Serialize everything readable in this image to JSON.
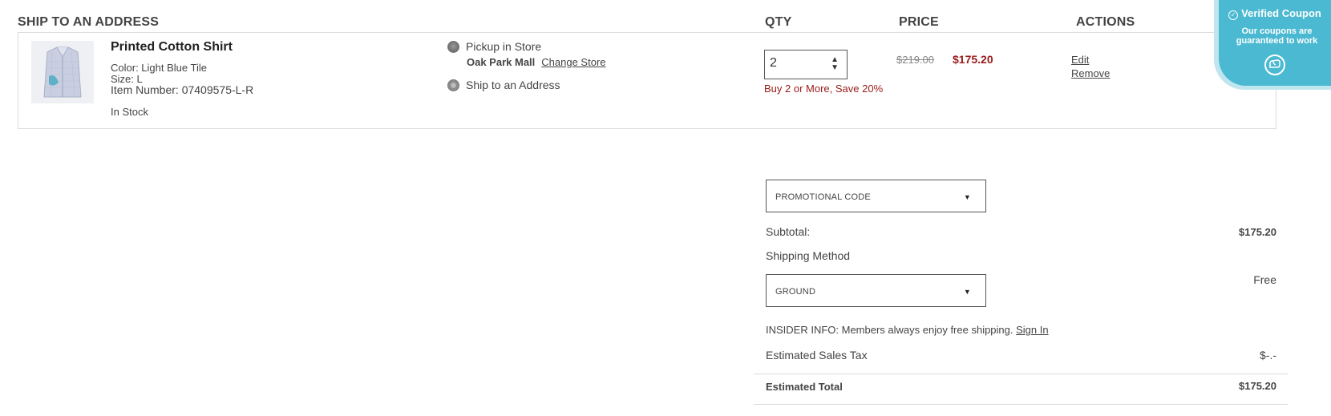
{
  "headers": {
    "ship_to": "SHIP TO AN ADDRESS",
    "qty": "QTY",
    "price": "PRICE",
    "actions": "ACTIONS"
  },
  "item": {
    "name": "Printed Cotton Shirt",
    "color": "Color: Light Blue Tile",
    "size": "Size: L",
    "item_number": "Item Number: 07409575-L-R",
    "stock": "In Stock",
    "fulfillment": {
      "pickup_label": "Pickup in Store",
      "store_name": "Oak Park Mall",
      "change_store": "Change Store",
      "ship_label": "Ship to an Address",
      "selected": "ship"
    },
    "qty": "2",
    "qty_promo": "Buy 2 or More, Save 20%",
    "price_original": "$219.00",
    "price_sale": "$175.20",
    "actions": {
      "edit": "Edit",
      "remove": "Remove"
    }
  },
  "coupon_badge": {
    "title": "Verified Coupon",
    "text": "Our coupons are guaranteed to work"
  },
  "summary": {
    "promo_dropdown": "PROMOTIONAL CODE",
    "subtotal_label": "Subtotal:",
    "subtotal_value": "$175.20",
    "shipping_method_label": "Shipping Method",
    "shipping_dropdown": "GROUND",
    "shipping_value": "Free",
    "insider_text": "INSIDER INFO: Members always enjoy free shipping.",
    "sign_in": "Sign In",
    "tax_label": "Estimated Sales Tax",
    "tax_value": "$-.-",
    "total_label": "Estimated Total",
    "total_value": "$175.20"
  },
  "colors": {
    "sale_red": "#9b1a1a",
    "coupon_blue": "#4ab9d1",
    "text_gray": "#444444",
    "border_gray": "#dcdcdc"
  }
}
